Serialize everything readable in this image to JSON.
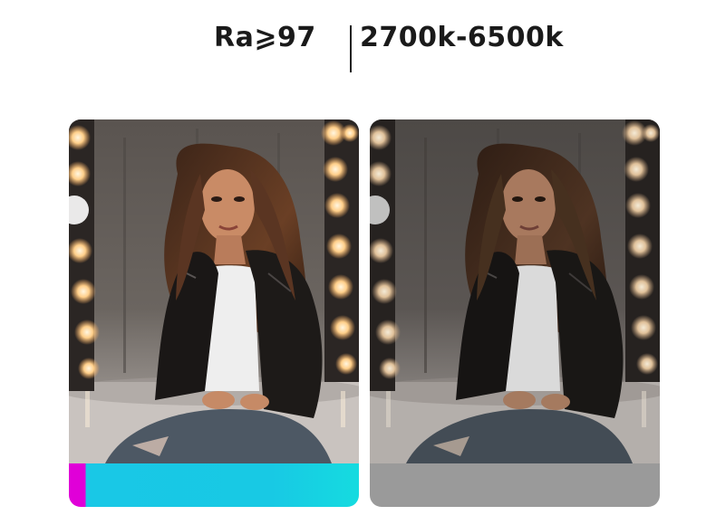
{
  "specs": {
    "cri": "Ra⩾97",
    "cct_range": "2700k-6500k"
  },
  "colors": {
    "text": "#1a1a1a",
    "rgb_bar_magenta": "#e000d8",
    "rgb_bar_cyan": "#18c9e4",
    "gray_bar": "#9a9a9a"
  },
  "comparison": {
    "left": {
      "photo_icon": "portrait-photo-vivid",
      "bar_style": "rgb-gradient"
    },
    "right": {
      "photo_icon": "portrait-photo-muted",
      "bar_style": "gray"
    }
  }
}
